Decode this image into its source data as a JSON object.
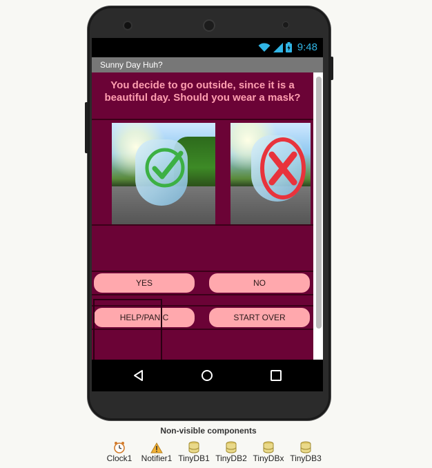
{
  "status": {
    "time": "9:48"
  },
  "app": {
    "title": "Sunny Day Huh?",
    "question": "You decide to go outside, since it is a beautiful day. Should you wear a mask?",
    "buttons": {
      "yes": "YES",
      "no": "NO",
      "help": "HELP/PANIC",
      "start_over": "START OVER"
    },
    "colors": {
      "background": "#6b0336",
      "question_text": "#ff9fb0",
      "button": "#ffa8ad",
      "status_accent": "#31b5e5"
    }
  },
  "non_visible": {
    "title": "Non-visible components",
    "items": [
      {
        "label": "Clock1",
        "icon": "clock-icon"
      },
      {
        "label": "Notifier1",
        "icon": "warning-icon"
      },
      {
        "label": "TinyDB1",
        "icon": "database-icon"
      },
      {
        "label": "TinyDB2",
        "icon": "database-icon"
      },
      {
        "label": "TinyDBx",
        "icon": "database-icon"
      },
      {
        "label": "TinyDB3",
        "icon": "database-icon"
      }
    ]
  }
}
